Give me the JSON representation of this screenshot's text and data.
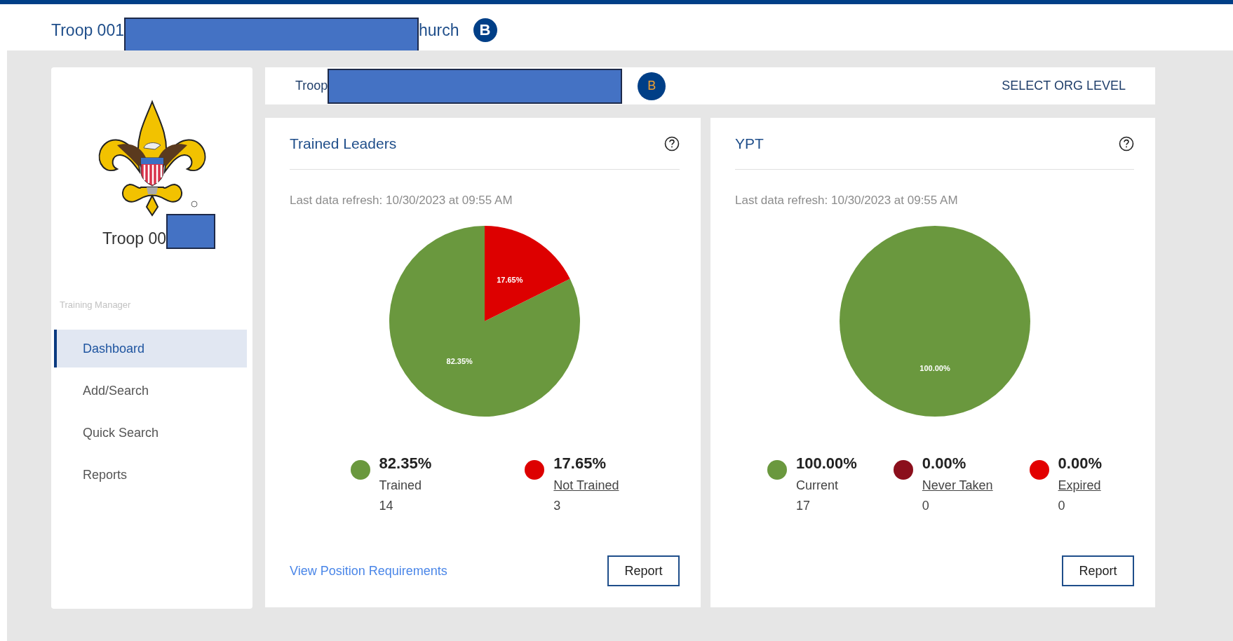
{
  "header": {
    "title_start": "Troop 001",
    "title_end": "hurch",
    "badge": "B"
  },
  "sidebar": {
    "unit_name": "Troop 00",
    "section_label": "Training Manager",
    "items": [
      {
        "label": "Dashboard",
        "selected": true
      },
      {
        "label": "Add/Search",
        "selected": false
      },
      {
        "label": "Quick Search",
        "selected": false
      },
      {
        "label": "Reports",
        "selected": false
      }
    ]
  },
  "org_bar": {
    "unit_name": "Troop",
    "badge": "B",
    "action": "SELECT ORG LEVEL"
  },
  "cards": [
    {
      "title": "Trained Leaders",
      "refresh": "Last data refresh: 10/30/2023 at 09:55 AM",
      "chart_data": {
        "type": "pie",
        "values": [
          82.35,
          17.65
        ],
        "value_labels": [
          "82.35%",
          "17.65%"
        ]
      },
      "legend": [
        {
          "percent": "82.35%",
          "label": "Trained",
          "count": "14",
          "color": "#6a983e",
          "link": false
        },
        {
          "percent": "17.65%",
          "label": "Not Trained",
          "count": "3",
          "color": "#dd0000",
          "link": true
        }
      ],
      "footer_link": "View Position Requirements",
      "button": "Report"
    },
    {
      "title": "YPT",
      "refresh": "Last data refresh: 10/30/2023 at 09:55 AM",
      "chart_data": {
        "type": "pie",
        "values": [
          100,
          0,
          0
        ],
        "value_labels": [
          "100.00%",
          null,
          null
        ]
      },
      "legend": [
        {
          "percent": "100.00%",
          "label": "Current",
          "count": "17",
          "color": "#6a983e",
          "link": false
        },
        {
          "percent": "0.00%",
          "label": "Never Taken",
          "count": "0",
          "color": "#8b0f1c",
          "link": true
        },
        {
          "percent": "0.00%",
          "label": "Expired",
          "count": "0",
          "color": "#e20000",
          "link": true
        }
      ],
      "button": "Report"
    }
  ]
}
